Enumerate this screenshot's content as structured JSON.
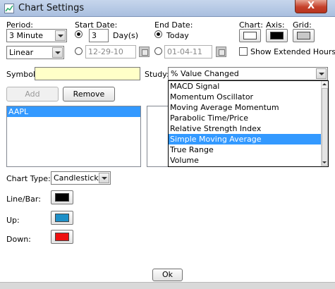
{
  "window": {
    "title": "Chart Settings",
    "close_label": "X"
  },
  "period": {
    "label": "Period:",
    "value": "3 Minute",
    "scale": "Linear"
  },
  "start_date": {
    "label": "Start Date:",
    "days_value": "3",
    "days_label": "Day(s)",
    "date_value": "12-29-10"
  },
  "end_date": {
    "label": "End Date:",
    "today_label": "Today",
    "date_value": "01-04-11"
  },
  "colors_row": {
    "chart_label": "Chart:",
    "axis_label": "Axis:",
    "grid_label": "Grid:",
    "chart_color": "#ffffff",
    "axis_color": "#000000",
    "grid_color": "#c8c8c8"
  },
  "extended_hours": {
    "label": "Show Extended Hours"
  },
  "symbol": {
    "label": "Symbol:",
    "value": ""
  },
  "study": {
    "label": "Study:",
    "value": "% Value Changed",
    "options": [
      "MACD Signal",
      "Momentum Oscillator",
      "Moving Average Momentum",
      "Parabolic Time/Price",
      "Relative Strength Index",
      "Simple Moving Average",
      "True Range",
      "Volume"
    ],
    "selected": "Simple Moving Average"
  },
  "buttons": {
    "add": "Add",
    "remove": "Remove",
    "ok": "Ok"
  },
  "symbols_list": [
    "AAPL"
  ],
  "chart_type": {
    "label": "Chart Type:",
    "value": "Candlestick"
  },
  "line_bar": {
    "label": "Line/Bar:",
    "color": "#000000"
  },
  "up": {
    "label": "Up:",
    "color": "#1e90c8"
  },
  "down": {
    "label": "Down:",
    "color": "#ee1111"
  }
}
